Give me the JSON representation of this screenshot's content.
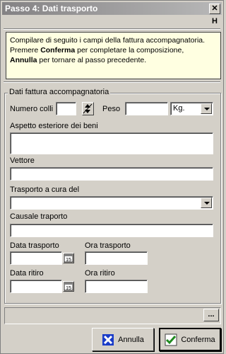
{
  "window": {
    "title": "Passo 4: Dati trasporto",
    "close_label": "✕",
    "help_label": "H"
  },
  "info": {
    "line1": "Compilare di seguito i campi della fattura accompagnatoria.",
    "line2_pre": "Premere ",
    "line2_bold": "Conferma",
    "line2_post": " per completare la composizione,",
    "line3_bold": "Annulla",
    "line3_post": " per tornare al passo precedente."
  },
  "group": {
    "legend": "Dati fattura accompagnatoria",
    "numero_colli_label": "Numero colli",
    "numero_colli_value": "",
    "peso_label": "Peso",
    "peso_value": "",
    "peso_unit": "Kg.",
    "aspetto_label": "Aspetto esteriore dei beni",
    "vettore_label": "Vettore",
    "trasporto_label": "Trasporto a cura del",
    "causale_label": "Causale traporto",
    "data_trasporto_label": "Data trasporto",
    "ora_trasporto_label": "Ora trasporto",
    "data_ritiro_label": "Data ritiro",
    "ora_ritiro_label": "Ora ritiro",
    "calendar_day": "15"
  },
  "status": {
    "dots_label": "..."
  },
  "buttons": {
    "annulla": "Annulla",
    "conferma": "Conferma"
  },
  "colors": {
    "info_bg": "#ffffe1",
    "annulla_icon": "#1a3cc8",
    "conferma_icon": "#1f8a1f"
  }
}
